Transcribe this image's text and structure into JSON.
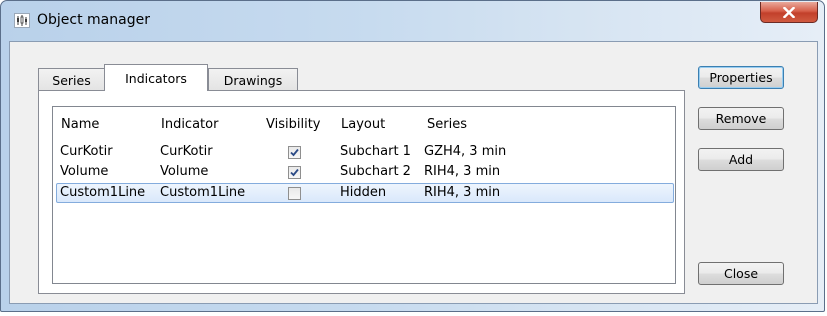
{
  "window": {
    "title": "Object manager",
    "app_icon": "chart-icon",
    "close_icon": "close-x-icon"
  },
  "tabs": [
    {
      "label": "Series",
      "active": false
    },
    {
      "label": "Indicators",
      "active": true
    },
    {
      "label": "Drawings",
      "active": false
    }
  ],
  "list": {
    "columns": [
      "Name",
      "Indicator",
      "Visibility",
      "Layout",
      "Series"
    ],
    "rows": [
      {
        "name": "CurKotir",
        "indicator": "CurKotir",
        "visible": true,
        "layout": "Subchart 1",
        "series": "GZH4, 3 min",
        "selected": false
      },
      {
        "name": "Volume",
        "indicator": "Volume",
        "visible": true,
        "layout": "Subchart 2",
        "series": "RIH4, 3 min",
        "selected": false
      },
      {
        "name": "Custom1Line",
        "indicator": "Custom1Line",
        "visible": false,
        "layout": "Hidden",
        "series": "RIH4, 3 min",
        "selected": true
      }
    ]
  },
  "buttons": {
    "properties": "Properties",
    "remove": "Remove",
    "add": "Add",
    "close": "Close"
  },
  "colors": {
    "title_gradient_start": "#b9d1ea",
    "close_button": "#c7432f",
    "selection": "#d9e8fb",
    "checkmark": "#2b4a86"
  }
}
